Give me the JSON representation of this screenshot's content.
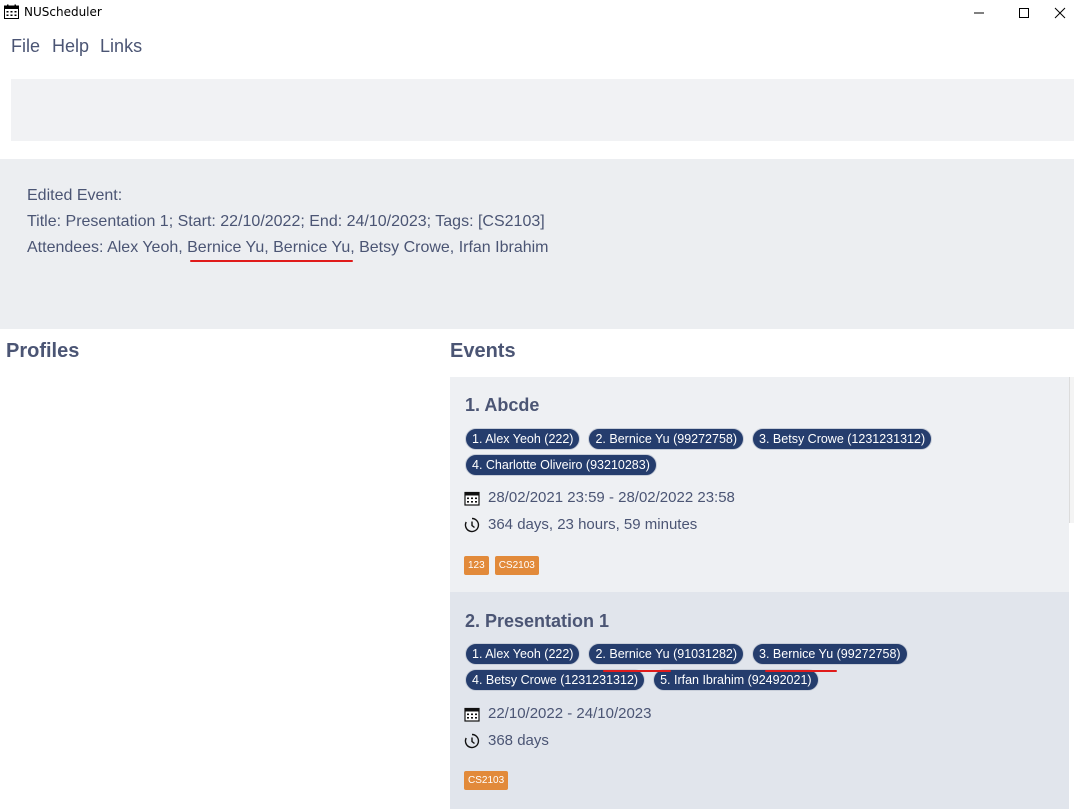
{
  "window": {
    "title": "NUScheduler"
  },
  "menu": {
    "file": "File",
    "help": "Help",
    "links": "Links"
  },
  "command_box": {
    "value": ""
  },
  "result": {
    "line1": "Edited Event:",
    "line2": "Title: Presentation 1; Start: 22/10/2022; End: 24/10/2023; Tags: [CS2103]",
    "line3": "Attendees: Alex Yeoh, Bernice Yu, Bernice Yu, Betsy Crowe, Irfan Ibrahim"
  },
  "profiles": {
    "title": "Profiles"
  },
  "events": {
    "title": "Events",
    "items": [
      {
        "title": "1.  Abcde",
        "attendees": [
          "1. Alex Yeoh (222)",
          "2. Bernice Yu (99272758)",
          "3. Betsy Crowe (1231231312)",
          "4. Charlotte Oliveiro (93210283)"
        ],
        "datetime": "28/02/2021 23:59 - 28/02/2022 23:58",
        "duration": "364 days, 23 hours, 59 minutes",
        "tags": [
          "123",
          "CS2103"
        ]
      },
      {
        "title": "2.  Presentation 1",
        "attendees": [
          "1. Alex Yeoh (222)",
          "2. Bernice Yu (91031282)",
          "3. Bernice Yu (99272758)",
          "4. Betsy Crowe (1231231312)",
          "5. Irfan Ibrahim (92492021)"
        ],
        "datetime": "22/10/2022 - 24/10/2023",
        "duration": "368 days",
        "tags": [
          "CS2103"
        ]
      }
    ]
  },
  "colors": {
    "accent": "#253d6d",
    "tag": "#e28a3a",
    "text": "#4b5574",
    "annotation": "#e01b1b"
  }
}
